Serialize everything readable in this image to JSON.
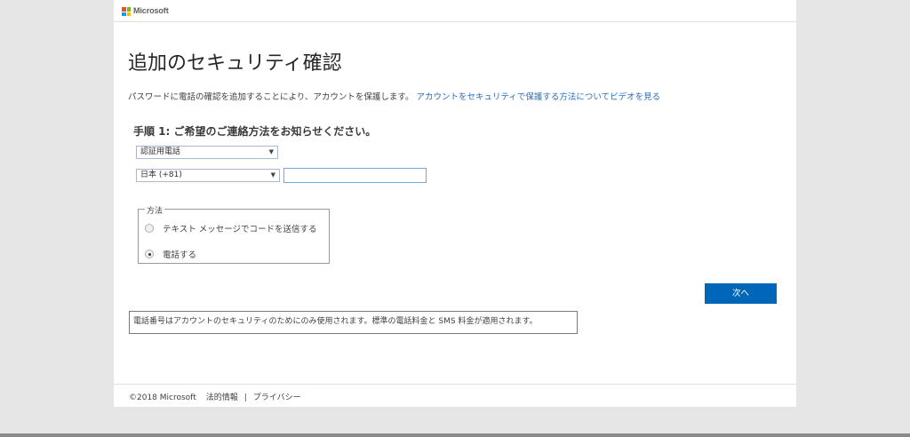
{
  "header": {
    "logo_text": "Microsoft",
    "logo_colors": [
      "#f25022",
      "#7fba00",
      "#00a4ef",
      "#ffb900"
    ]
  },
  "title": "追加のセキュリティ確認",
  "intro": {
    "text": "パスワードに電話の確認を追加することにより、アカウントを保護します。",
    "link": "アカウントをセキュリティで保護する方法についてビデオを見る"
  },
  "step_heading": "手順 1: ご希望のご連絡方法をお知らせください。",
  "method_select": {
    "value": "認証用電話"
  },
  "country_select": {
    "value": "日本 (+81)"
  },
  "phone_input": {
    "value": "",
    "placeholder": ""
  },
  "method_group": {
    "legend": "方法",
    "options": [
      {
        "label": "テキスト メッセージでコードを送信する",
        "checked": false
      },
      {
        "label": "電話する",
        "checked": true
      }
    ]
  },
  "next_button": "次へ",
  "notice": "電話番号はアカウントのセキュリティのためにのみ使用されます。標準の電話料金と SMS 料金が適用されます。",
  "footer": {
    "copyright": "©2018 Microsoft",
    "legal": "法的情報",
    "separator": "|",
    "privacy": "プライバシー"
  },
  "colors": {
    "accent": "#0067b8",
    "link": "#2a6fb8"
  }
}
